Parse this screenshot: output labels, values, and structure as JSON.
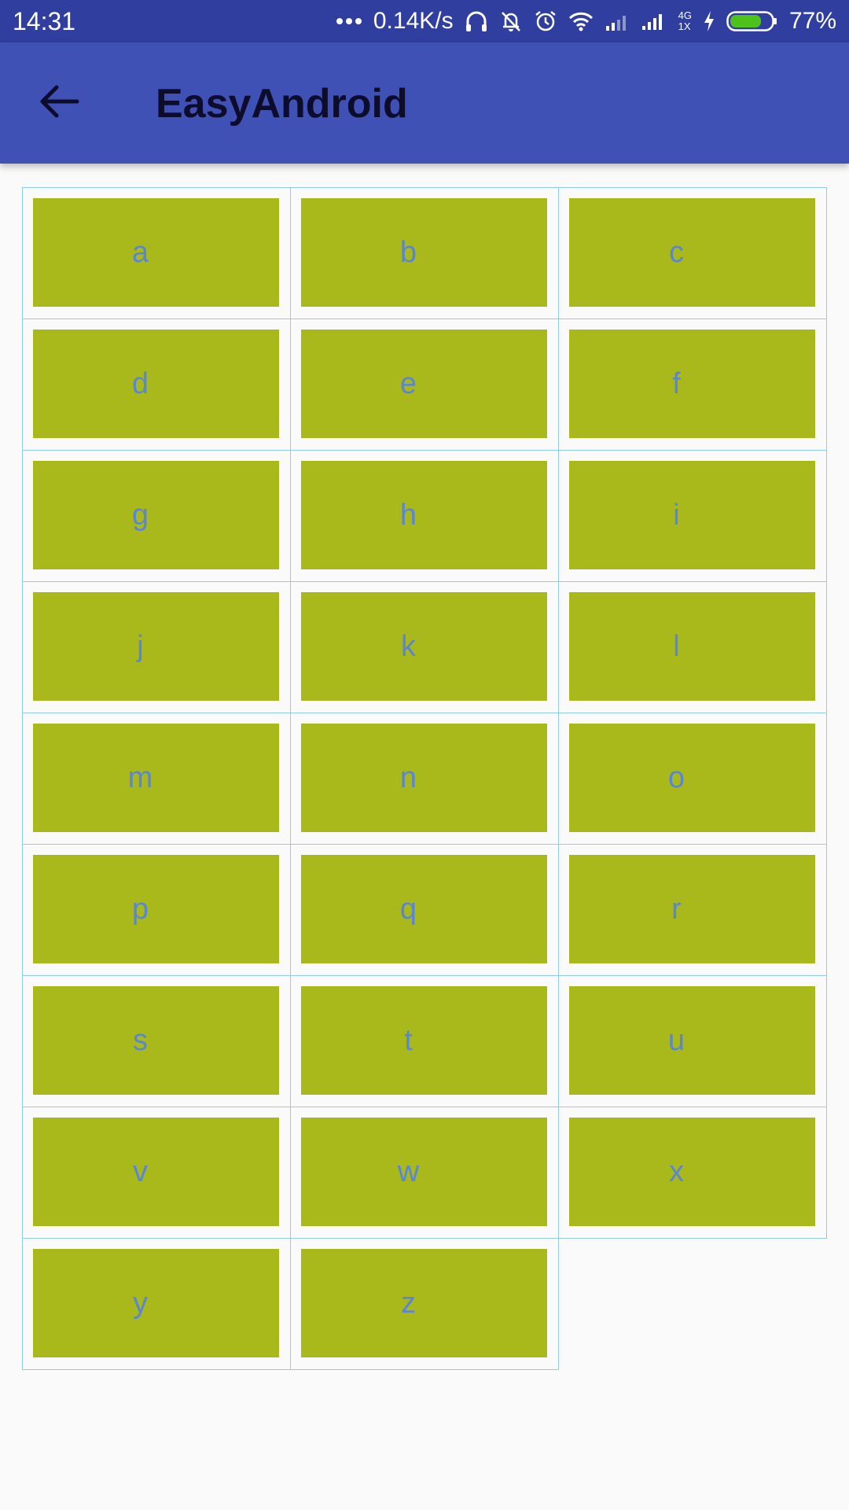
{
  "status_bar": {
    "time": "14:31",
    "more_icon": "ellipsis-icon",
    "network_speed": "0.14K/s",
    "icons": [
      "headphones-icon",
      "bell-off-icon",
      "alarm-icon",
      "wifi-icon",
      "signal-icon",
      "signal-4g-icon",
      "charging-icon",
      "battery-icon"
    ],
    "net_label_top": "4G",
    "net_label_bottom": "1X",
    "battery_percent": "77%",
    "battery_level": 0.77,
    "battery_color": "#4cc21b"
  },
  "app_bar": {
    "back_icon": "arrow-left-icon",
    "title": "EasyAndroid",
    "background": "#3f51b5"
  },
  "keys": {
    "k0": "a",
    "k1": "b",
    "k2": "c",
    "k3": "d",
    "k4": "e",
    "k5": "f",
    "k6": "g",
    "k7": "h",
    "k8": "i",
    "k9": "j",
    "k10": "k",
    "k11": "l",
    "k12": "m",
    "k13": "n",
    "k14": "o",
    "k15": "p",
    "k16": "q",
    "k17": "r",
    "k18": "s",
    "k19": "t",
    "k20": "u",
    "k21": "v",
    "k22": "w",
    "k23": "x",
    "k24": "y",
    "k25": "z"
  },
  "colors": {
    "key_background": "#a9b91b",
    "key_text": "#5b86d6",
    "cell_border": "#90caf9"
  }
}
